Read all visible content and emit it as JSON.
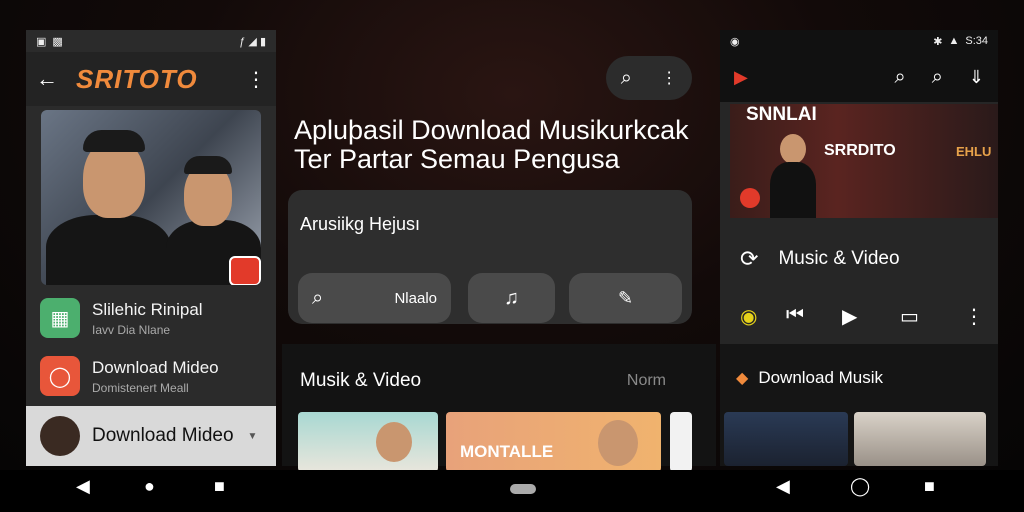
{
  "left": {
    "status_right": "ƒ ◢ ▮",
    "brand": "SRITOTO",
    "back_glyph": "←",
    "more_glyph": "⋮",
    "items": [
      {
        "title": "Slilehic Rinipal",
        "subtitle": "Iavv Dia Nlane",
        "color": "#4caf6e"
      },
      {
        "title": "Download Mideo",
        "subtitle": "Domistenert Meall",
        "color": "#e8563a"
      },
      {
        "title": "Download Mideo",
        "subtitle": ""
      }
    ]
  },
  "center": {
    "headline_line1": "Apluþasil Download Musikurkcak",
    "headline_line2": "Ter Partar Semau Pengusa",
    "card_title": "Arusiikg Hejusı",
    "search_label": "Nlaalo",
    "section_title": "Musik & Video",
    "section_more": "Norm",
    "thumb_text": "MONTALLE",
    "search_glyph": "⌕",
    "more_glyph": "⋮"
  },
  "right": {
    "status_time": "S:34",
    "banner_text": "SRRDITO",
    "banner_top": "SNNLAI",
    "banner_sign": "EHLU",
    "music_label": "Music & Video",
    "download_label": "Download Musik"
  },
  "colors": {
    "accent": "#f08a3c",
    "yellow": "#e6d21a"
  }
}
